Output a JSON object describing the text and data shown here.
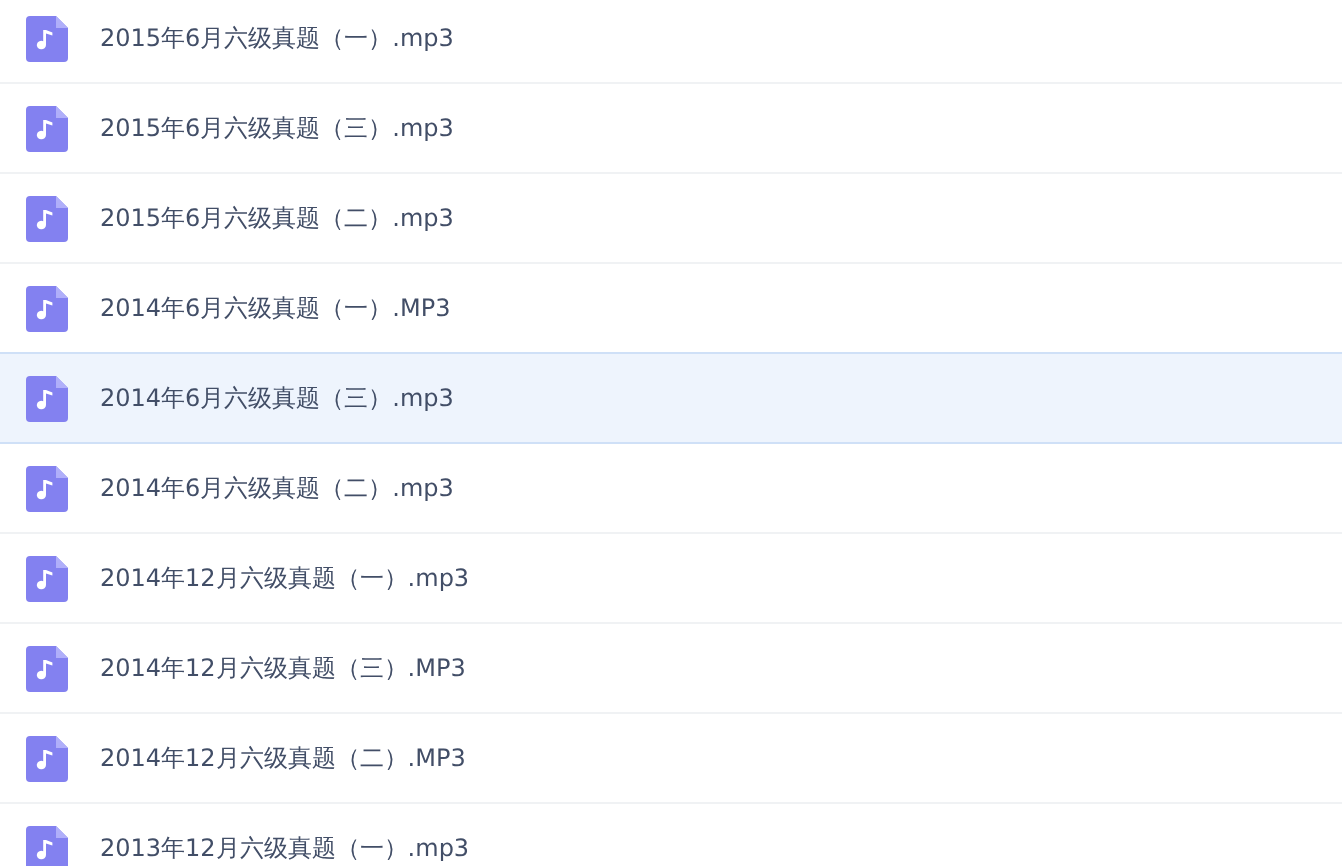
{
  "files": [
    {
      "name": "2015年6月六级真题（一）.mp3",
      "hovered": false
    },
    {
      "name": "2015年6月六级真题（三）.mp3",
      "hovered": false
    },
    {
      "name": "2015年6月六级真题（二）.mp3",
      "hovered": false
    },
    {
      "name": "2014年6月六级真题（一）.MP3",
      "hovered": false
    },
    {
      "name": "2014年6月六级真题（三）.mp3",
      "hovered": true
    },
    {
      "name": "2014年6月六级真题（二）.mp3",
      "hovered": false
    },
    {
      "name": "2014年12月六级真题（一）.mp3",
      "hovered": false
    },
    {
      "name": "2014年12月六级真题（三）.MP3",
      "hovered": false
    },
    {
      "name": "2014年12月六级真题（二）.MP3",
      "hovered": false
    },
    {
      "name": "2013年12月六级真题（一）.mp3",
      "hovered": false
    }
  ]
}
